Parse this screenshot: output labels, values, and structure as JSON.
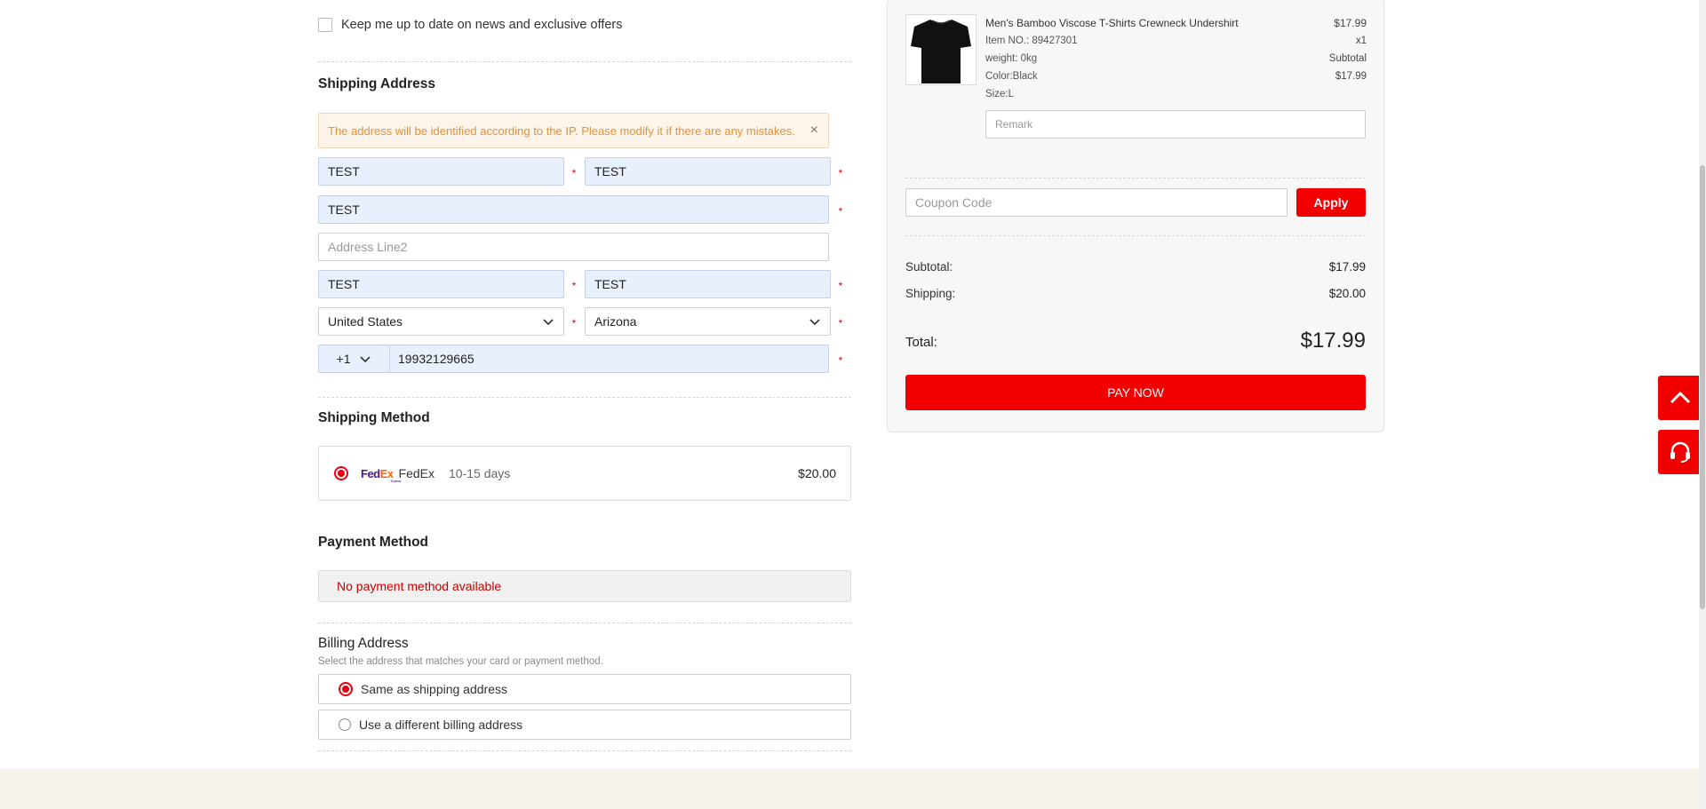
{
  "newsletter": {
    "label": "Keep me up to date on news and exclusive offers"
  },
  "shipping_address": {
    "title": "Shipping Address",
    "notice": "The address will be identified according to the IP. Please modify it if there are any mistakes.",
    "close_glyph": "×",
    "first_name": "TEST",
    "last_name": "TEST",
    "address_line1": "TEST",
    "address_line2_placeholder": "Address Line2",
    "city": "TEST",
    "zip": "TEST",
    "country": "United States",
    "state": "Arizona",
    "phone_code": "+1",
    "phone": "19932129665",
    "required_mark": "*"
  },
  "shipping_method": {
    "title": "Shipping Method",
    "carrier_logo": {
      "fe": "Fed",
      "ex": "Ex",
      "tag": "Express"
    },
    "carrier": "FedEx",
    "days": "10-15 days",
    "price": "$20.00"
  },
  "payment_method": {
    "title": "Payment Method",
    "message": "No payment method available"
  },
  "billing_address": {
    "title": "Billing Address",
    "subtitle": "Select the address that matches your card or payment method.",
    "options": [
      "Same as shipping address",
      "Use a different billing address"
    ]
  },
  "order": {
    "product": {
      "title": "Men's Bamboo Viscose T-Shirts Crewneck Undershirt",
      "item_no": "Item NO.: 89427301",
      "weight": "weight: 0kg",
      "color": "Color:Black",
      "size": "Size:L",
      "price": "$17.99",
      "qty": "x1",
      "subtotal_label": "Subtotal",
      "subtotal": "$17.99"
    },
    "remark_placeholder": "Remark",
    "coupon_placeholder": "Coupon Code",
    "apply_label": "Apply",
    "subtotal_label": "Subtotal:",
    "subtotal": "$17.99",
    "shipping_label": "Shipping:",
    "shipping": "$20.00",
    "total_label": "Total:",
    "total": "$17.99",
    "pay_label": "PAY NOW"
  },
  "floating": {
    "top_icon": "chevron-up-icon",
    "support_icon": "headset-icon"
  },
  "colors": {
    "accent": "#f20000",
    "notice_text": "#e3913a",
    "autofill_bg": "#e8f0fd",
    "footer": "#f6f3ea"
  }
}
